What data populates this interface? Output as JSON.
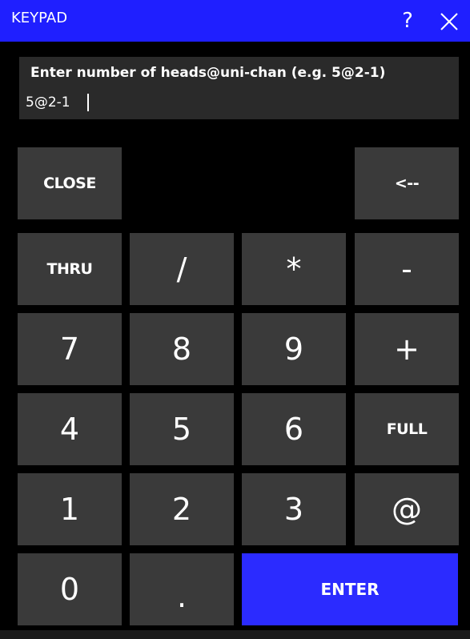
{
  "window": {
    "title": "KEYPAD",
    "help_label": "?"
  },
  "prompt": {
    "label": "Enter number of heads@uni-chan  (e.g. 5@2-1)",
    "value": "5@2-1"
  },
  "keys": {
    "close": "CLOSE",
    "backspace": "<--",
    "thru": "THRU",
    "slash": "/",
    "asterisk": "*",
    "minus": "-",
    "seven": "7",
    "eight": "8",
    "nine": "9",
    "plus": "+",
    "four": "4",
    "five": "5",
    "six": "6",
    "full": "FULL",
    "one": "1",
    "two": "2",
    "three": "3",
    "at": "@",
    "zero": "0",
    "dot": ".",
    "enter": "ENTER"
  },
  "colors": {
    "titlebar": "#1f1fff",
    "key": "#3a3a3a",
    "enter": "#2b2bff",
    "background": "#000000"
  }
}
